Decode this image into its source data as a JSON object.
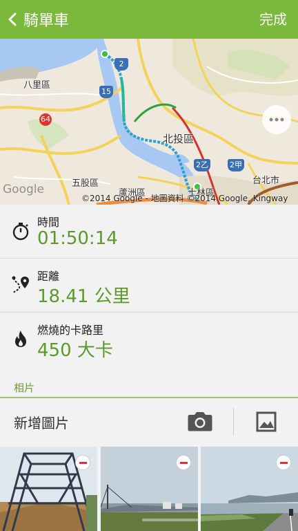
{
  "header": {
    "title": "騎單車",
    "done_label": "完成",
    "color": "#7ab93b"
  },
  "map": {
    "labels": {
      "bali": "八里區",
      "beitou": "北投區",
      "wugu": "五股區",
      "luzhou": "蘆洲區",
      "shilin": "士林區",
      "taipei": "台北市"
    },
    "road_shields": {
      "r2": "2",
      "r15": "15",
      "r64": "64",
      "r2b": "2乙",
      "r2a": "2甲"
    },
    "copyright": "©2014 Google - 地圖資料 ©2014 Google, Kingway",
    "watermark": "Google"
  },
  "stats": {
    "time": {
      "label": "時間",
      "value": "01:50:14"
    },
    "distance": {
      "label": "距離",
      "value": "18.41 公里"
    },
    "calories": {
      "label": "燃燒的卡路里",
      "value": "450 大卡"
    }
  },
  "photos": {
    "section_title": "相片",
    "add_label": "新增圖片"
  },
  "colors": {
    "accent": "#7ab93b",
    "value_text": "#5a9a2a",
    "remove": "#d8343a"
  }
}
